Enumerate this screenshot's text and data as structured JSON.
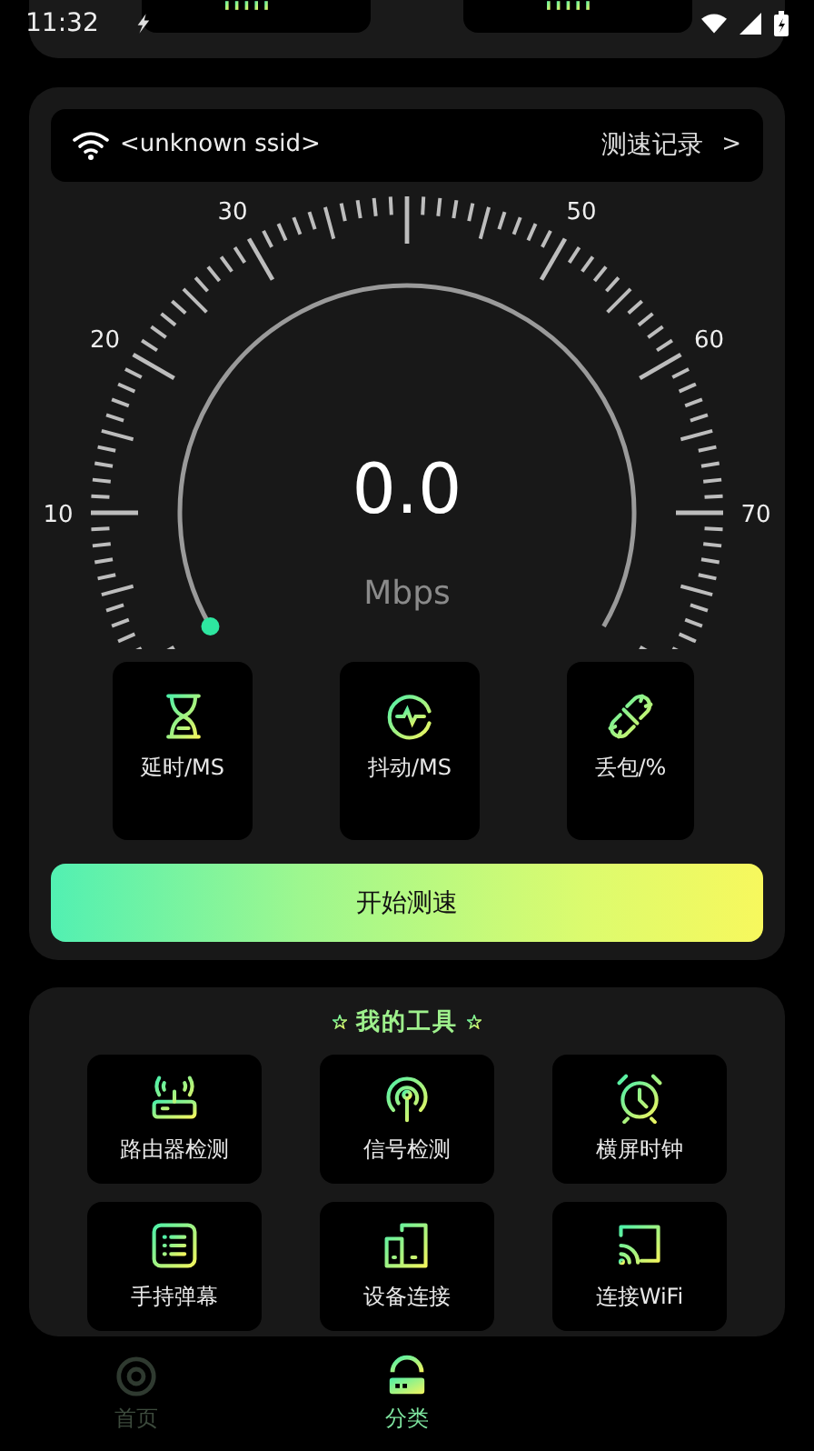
{
  "status_bar": {
    "time": "11:32"
  },
  "speed_test": {
    "ssid": "<unknown ssid>",
    "history_link": "测速记录",
    "history_arrow": ">",
    "gauge": {
      "labels": [
        "10",
        "20",
        "30",
        "50",
        "60",
        "70"
      ],
      "speed": "0.0",
      "unit": "Mbps"
    },
    "metrics": [
      {
        "label": "延时/MS",
        "kind": "latency"
      },
      {
        "label": "抖动/MS",
        "kind": "jitter"
      },
      {
        "label": "丢包/%",
        "kind": "loss"
      }
    ],
    "start_button": "开始测速"
  },
  "tools": {
    "title": "我的工具",
    "items": [
      {
        "label": "路由器检测",
        "kind": "router"
      },
      {
        "label": "信号检测",
        "kind": "signal"
      },
      {
        "label": "横屏时钟",
        "kind": "clock"
      },
      {
        "label": "手持弹幕",
        "kind": "list"
      },
      {
        "label": "设备连接",
        "kind": "devices"
      },
      {
        "label": "连接WiFi",
        "kind": "cast"
      }
    ]
  },
  "nav": [
    {
      "label": "首页",
      "kind": "home",
      "selected": false
    },
    {
      "label": "分类",
      "kind": "category",
      "selected": true
    }
  ]
}
